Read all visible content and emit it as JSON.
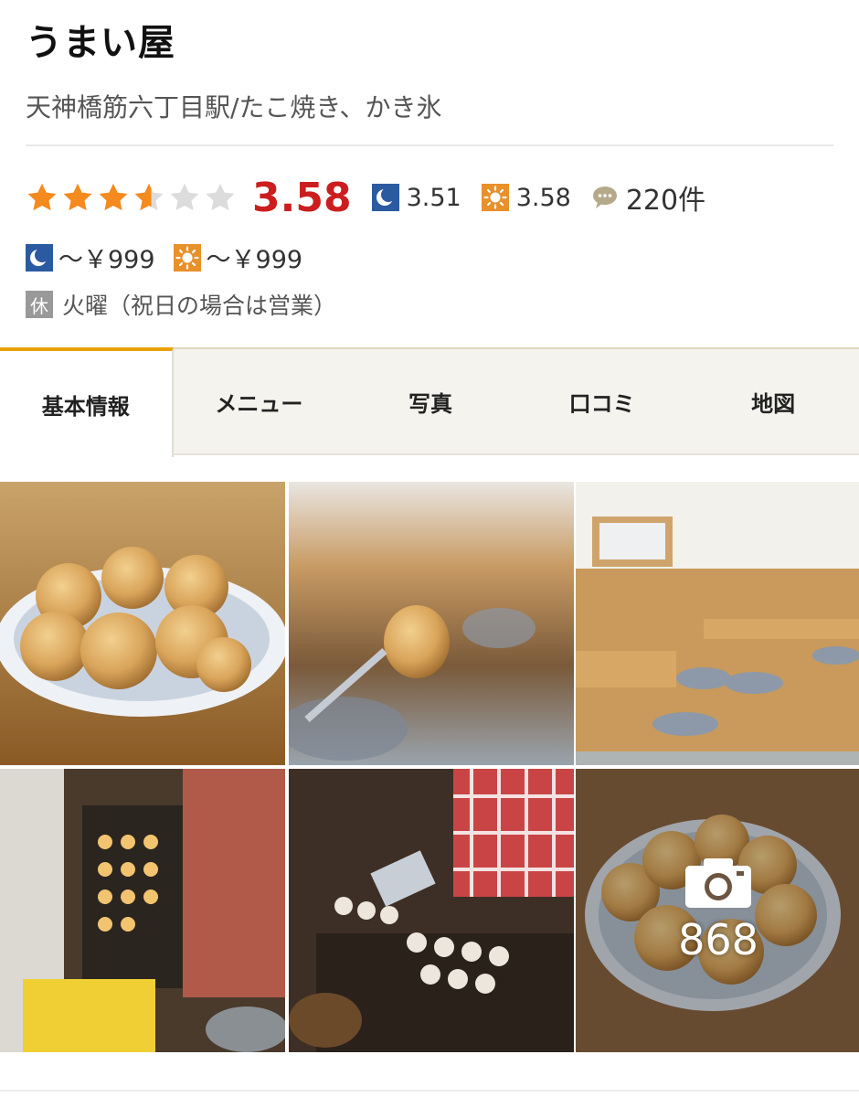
{
  "store": {
    "name": "うまい屋",
    "station_genre": "天神橋筋六丁目駅/たこ焼き、かき氷"
  },
  "rating": {
    "score": "3.58",
    "stars_value": 3.58,
    "dinner_score": "3.51",
    "lunch_score": "3.58",
    "review_count": "220件"
  },
  "price": {
    "dinner": "～￥999",
    "lunch": "～￥999"
  },
  "closed": {
    "badge": "休",
    "text": "火曜（祝日の場合は営業）"
  },
  "tabs": [
    {
      "label": "基本情報",
      "active": true
    },
    {
      "label": "メニュー"
    },
    {
      "label": "写真"
    },
    {
      "label": "口コミ"
    },
    {
      "label": "地図"
    }
  ],
  "gallery": {
    "photo_count": "868"
  },
  "colors": {
    "star_fill": "#f58a1f",
    "star_empty": "#dcdcdc",
    "score": "#cc1e1e",
    "dinner_icon": "#2c5aa0",
    "lunch_icon": "#e8902a",
    "tab_active_border": "#e8a200"
  },
  "icons": {
    "dinner": "moon-icon",
    "lunch": "sun-icon",
    "reviews": "speech-bubble-icon",
    "photos": "camera-icon"
  }
}
